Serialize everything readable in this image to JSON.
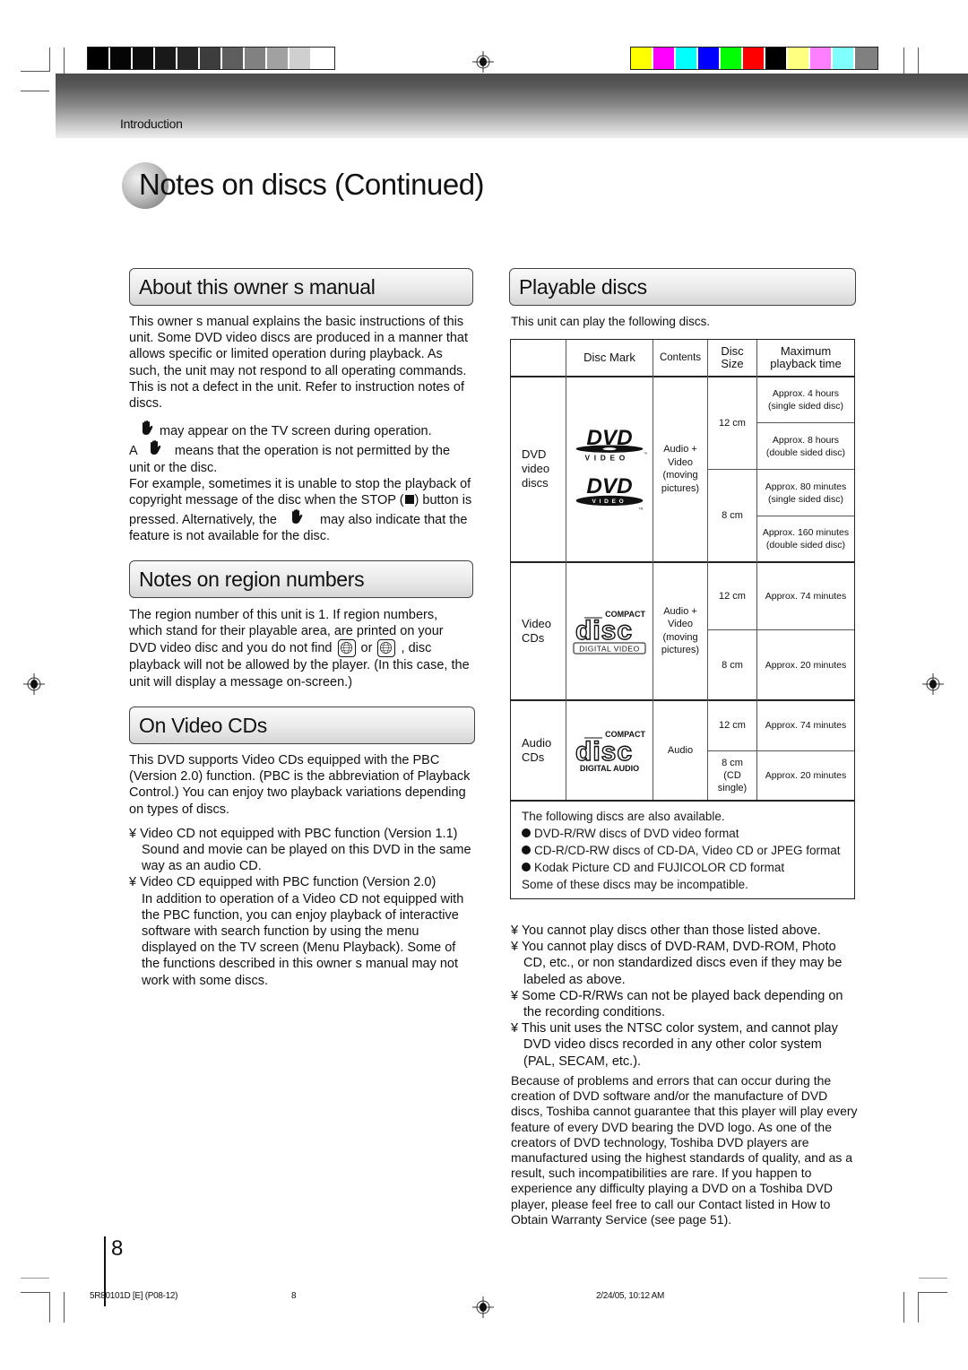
{
  "header": {
    "section_label": "Introduction",
    "gray_swatches": [
      "#000000",
      "#050505",
      "#0d0d0d",
      "#191919",
      "#262626",
      "#3d3d3d",
      "#5e5e5e",
      "#818181",
      "#a1a1a1",
      "#cfcfcf",
      "#ffffff"
    ],
    "color_swatches": [
      "#ffff00",
      "#ff00ff",
      "#00ffff",
      "#0000ff",
      "#00ff00",
      "#ff0000",
      "#000000",
      "#ffff80",
      "#ff80ff",
      "#80ffff",
      "#808080"
    ]
  },
  "page": {
    "title": "Notes on discs (Continued)",
    "page_number": "8"
  },
  "about": {
    "heading": "About this owner s manual",
    "para1": "This owner s manual explains the basic instructions of this unit. Some DVD video discs are produced in a manner that allows specific or limited operation during playback. As such, the unit may not respond to all operating commands. This is not a defect in the unit. Refer to instruction notes of discs.",
    "line1_after_icon": " may appear on the TV screen during operation.",
    "line2_before_icon": "A ",
    "line2_after_icon": " means that the operation is not permitted by the unit or the disc.",
    "para3_a": "For example, sometimes it is unable to stop the playback of copyright message of the disc when the STOP (",
    "para3_b": ") button is pressed. Alternatively, the ",
    "para3_c": " may also indicate that the feature is not available for the disc."
  },
  "region": {
    "heading": "Notes on region numbers",
    "text_a": "The region number of this unit is 1. If region numbers, which stand for their playable area, are printed on your DVD video disc and you do not find ",
    "text_or": " or ",
    "text_b": " , disc playback will not be allowed by the player. (In this case, the unit will display a message on-screen.)",
    "icon1_label": "1",
    "icon2_label": "ALL"
  },
  "videocd": {
    "heading": "On Video CDs",
    "intro": "This DVD supports Video CDs equipped with the PBC (Version 2.0) function. (PBC is the abbreviation of Playback Control.) You can enjoy two playback variations depending on types of discs.",
    "items": [
      {
        "bullet": "¥ ",
        "title": "Video CD not equipped with PBC function (Version 1.1)",
        "desc": "Sound and movie can be played on this DVD in the same way as an audio CD."
      },
      {
        "bullet": "¥ ",
        "title": "Video CD equipped with PBC function (Version 2.0)",
        "desc": "In addition to operation of a Video CD not equipped with the PBC function, you can enjoy playback of interactive software with search function by using the menu displayed on the TV screen (Menu Playback). Some of the functions described in this owner s manual may not work with some discs."
      }
    ]
  },
  "playable": {
    "heading": "Playable discs",
    "intro": "This unit can play the following discs.",
    "table": {
      "headers": [
        "",
        "Disc Mark",
        "Contents",
        "Disc Size",
        "Maximum playback time"
      ],
      "rows": [
        {
          "type": "DVD video discs",
          "logo": "DVD VIDEO",
          "contents": "Audio + Video (moving pictures)",
          "sizes": [
            {
              "size": "12 cm",
              "times": [
                "Approx. 4 hours (single sided disc)",
                "Approx. 8 hours (double sided disc)"
              ]
            },
            {
              "size": "8 cm",
              "times": [
                "Approx. 80 minutes (single sided disc)",
                "Approx. 160 minutes (double sided disc)"
              ]
            }
          ]
        },
        {
          "type": "Video CDs",
          "logo": "COMPACT disc DIGITAL VIDEO",
          "contents": "Audio + Video (moving pictures)",
          "sizes": [
            {
              "size": "12 cm",
              "times": [
                "Approx. 74 minutes"
              ]
            },
            {
              "size": "8 cm",
              "times": [
                "Approx. 20 minutes"
              ]
            }
          ]
        },
        {
          "type": "Audio CDs",
          "logo": "COMPACT disc DIGITAL AUDIO",
          "contents": "Audio",
          "sizes": [
            {
              "size": "12 cm",
              "times": [
                "Approx. 74 minutes"
              ]
            },
            {
              "size": "8 cm (CD single)",
              "times": [
                "Approx. 20 minutes"
              ]
            }
          ]
        }
      ]
    },
    "also": {
      "intro": "The following discs are also available.",
      "items": [
        "DVD-R/RW discs of DVD video format",
        "CD-R/CD-RW discs of CD-DA, Video CD or JPEG format",
        "Kodak Picture CD and FUJICOLOR CD format"
      ],
      "note": "Some of these discs may be incompatible."
    },
    "notes": [
      "¥ You cannot play discs other than those listed above.",
      "¥ You cannot play discs of DVD-RAM, DVD-ROM, Photo CD, etc., or non standardized discs even if they may be labeled as above.",
      "¥ Some CD-R/RWs can not be played back depending on the recording conditions.",
      "¥ This unit uses the NTSC color system, and cannot play DVD video discs recorded in any other color system (PAL, SECAM, etc.)."
    ],
    "disclaimer": "Because of problems and errors that can occur during the creation of DVD software and/or the manufacture of DVD discs, Toshiba cannot guarantee that this player will play every feature of every DVD bearing the DVD logo.  As one of the creators of DVD technology, Toshiba DVD players are manufactured using the highest standards of quality, and as a result, such incompatibilities are rare.  If you happen to experience any difficulty playing a DVD on a Toshiba DVD player, please feel free to call our Contact listed in  How to Obtain Warranty Service  (see page 51)."
  },
  "footer": {
    "doc_code": "5R80101D [E] (P08-12)",
    "page": "8",
    "timestamp": "2/24/05, 10:12 AM"
  }
}
